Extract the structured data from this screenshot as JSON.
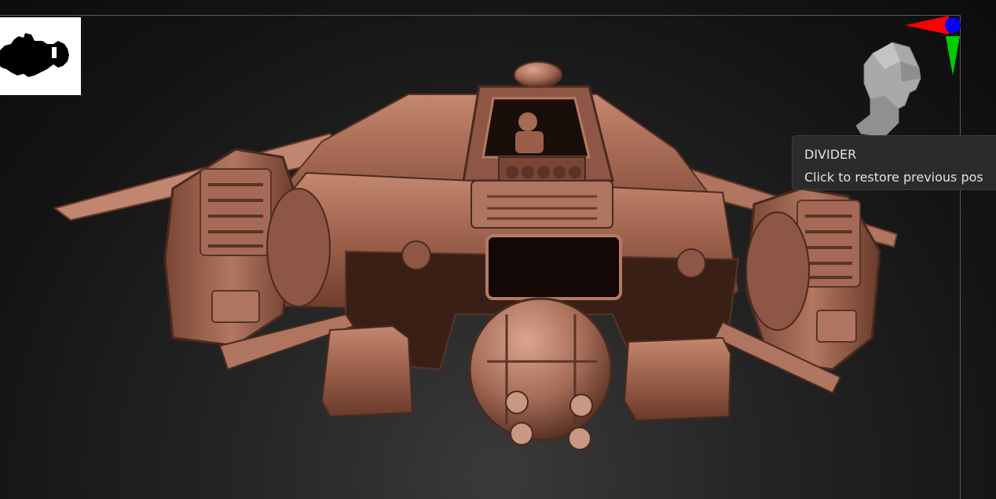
{
  "viewport": {
    "background": "#1b1b1b",
    "frame_color": "#5a5a5a"
  },
  "model": {
    "material_color": "#a46a55",
    "shadow_color": "#5a3426",
    "highlight_color": "#d9a893"
  },
  "orientation_widget": {
    "head_icon": "orientation-head-icon",
    "x_axis_color": "#ff0000",
    "y_axis_color": "#00cc00",
    "z_axis_color": "#0000ff"
  },
  "tooltip": {
    "title": "DIVIDER",
    "description": "Click to restore previous pos"
  }
}
